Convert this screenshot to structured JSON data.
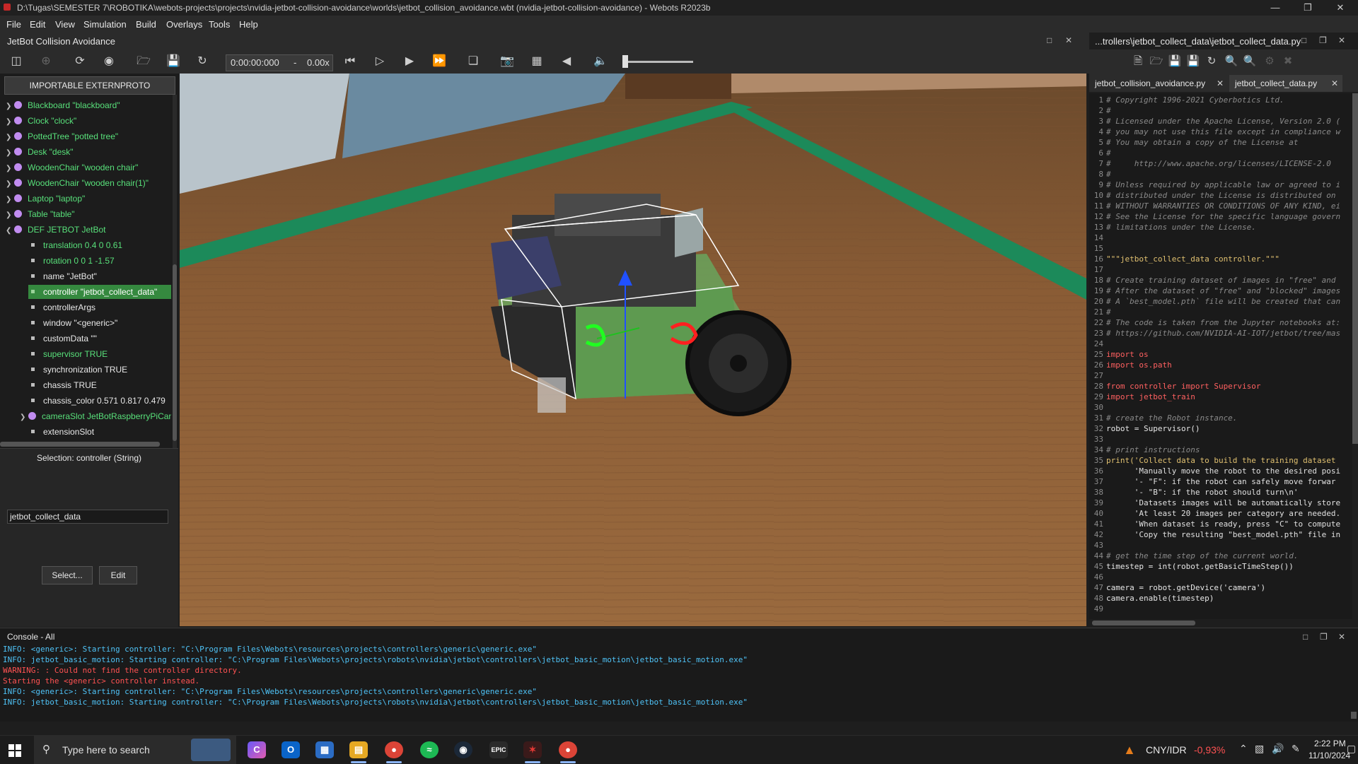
{
  "window": {
    "title": "D:\\Tugas\\SEMESTER 7\\ROBOTIKA\\webots-projects\\projects\\nvidia-jetbot-collision-avoidance\\worlds\\jetbot_collision_avoidance.wbt (nvidia-jetbot-collision-avoidance) - Webots R2023b"
  },
  "menu": [
    "File",
    "Edit",
    "View",
    "Simulation",
    "Build",
    "Overlays",
    "Tools",
    "Help"
  ],
  "world_title": "JetBot Collision Avoidance",
  "toolbar": {
    "time": "0:00:00:000",
    "separator": "-",
    "speed": "0.00x"
  },
  "scene_tree": {
    "proto_button": "IMPORTABLE EXTERNPROTO",
    "nodes": [
      "Blackboard \"blackboard\"",
      "Clock \"clock\"",
      "PottedTree \"potted tree\"",
      "Desk \"desk\"",
      "WoodenChair \"wooden chair\"",
      "WoodenChair \"wooden chair(1)\"",
      "Laptop \"laptop\"",
      "Table \"table\"",
      "DEF JETBOT JetBot"
    ],
    "fields": [
      "translation 0.4 0 0.61",
      "rotation 0 0 1 -1.57",
      "name \"JetBot\"",
      "controller \"jetbot_collect_data\"",
      "controllerArgs",
      "window \"<generic>\"",
      "customData \"\"",
      "supervisor TRUE",
      "synchronization TRUE",
      "chassis TRUE",
      "chassis_color 0.571 0.817 0.479",
      "cameraSlot JetBotRaspberryPiCamera",
      "extensionSlot"
    ]
  },
  "selection": {
    "label": "Selection: controller (String)",
    "value": "jetbot_collect_data",
    "select_button": "Select...",
    "edit_button": "Edit"
  },
  "editor": {
    "title": "...trollers\\jetbot_collect_data\\jetbot_collect_data.py",
    "tabs": [
      "jetbot_collision_avoidance.py",
      "jetbot_collect_data.py"
    ],
    "code_lines": [
      "# Copyright 1996-2021 Cyberbotics Ltd.",
      "#",
      "# Licensed under the Apache License, Version 2.0 (",
      "# you may not use this file except in compliance w",
      "# You may obtain a copy of the License at",
      "#",
      "#     http://www.apache.org/licenses/LICENSE-2.0",
      "#",
      "# Unless required by applicable law or agreed to i",
      "# distributed under the License is distributed on",
      "# WITHOUT WARRANTIES OR CONDITIONS OF ANY KIND, ei",
      "# See the License for the specific language govern",
      "# limitations under the License.",
      "",
      "",
      "\"\"\"jetbot_collect_data controller.\"\"\"",
      "",
      "# Create training dataset of images in \"free\" and",
      "# After the dataset of \"free\" and \"blocked\" images",
      "# A `best_model.pth` file will be created that can",
      "#",
      "# The code is taken from the Jupyter notebooks at:",
      "# https://github.com/NVIDIA-AI-IOT/jetbot/tree/mas",
      "",
      "import os",
      "import os.path",
      "",
      "from controller import Supervisor",
      "import jetbot_train",
      "",
      "# create the Robot instance.",
      "robot = Supervisor()",
      "",
      "# print instructions",
      "print('Collect data to build the training dataset",
      "      'Manually move the robot to the desired posi",
      "      '- \"F\": if the robot can safely move forwar",
      "      '- \"B\": if the robot should turn\\n'",
      "      'Datasets images will be automatically store",
      "      'At least 20 images per category are needed.",
      "      'When dataset is ready, press \"C\" to compute",
      "      'Copy the resulting \"best_model.pth\" file in",
      "",
      "# get the time step of the current world.",
      "timestep = int(robot.getBasicTimeStep())",
      "",
      "camera = robot.getDevice('camera')",
      "camera.enable(timestep)",
      ""
    ]
  },
  "console": {
    "title": "Console - All",
    "lines": [
      {
        "text": "INFO: <generic>: Starting controller: \"C:\\Program Files\\Webots\\resources\\projects\\controllers\\generic\\generic.exe\"",
        "color": "#4fc3f7"
      },
      {
        "text": "INFO: jetbot_basic_motion: Starting controller: \"C:\\Program Files\\Webots\\projects\\robots\\nvidia\\jetbot\\controllers\\jetbot_basic_motion\\jetbot_basic_motion.exe\"",
        "color": "#4fc3f7"
      },
      {
        "text": "WARNING: : Could not find the controller directory.",
        "color": "#ff5252"
      },
      {
        "text": "Starting the <generic> controller instead.",
        "color": "#ff5252"
      },
      {
        "text": "INFO: <generic>: Starting controller: \"C:\\Program Files\\Webots\\resources\\projects\\controllers\\generic\\generic.exe\"",
        "color": "#4fc3f7"
      },
      {
        "text": "INFO: jetbot_basic_motion: Starting controller: \"C:\\Program Files\\Webots\\projects\\robots\\nvidia\\jetbot\\controllers\\jetbot_basic_motion\\jetbot_basic_motion.exe\"",
        "color": "#4fc3f7"
      }
    ]
  },
  "taskbar": {
    "search_placeholder": "Type here to search",
    "ticker_name": "CNY/IDR",
    "ticker_change": "-0,93%",
    "time": "2:22 PM",
    "date": "11/10/2024"
  },
  "colors": {
    "accent_green": "#35893f",
    "tree_green": "#58e07a",
    "console_info": "#4fc3f7",
    "console_warn": "#ff5252",
    "ticker_red": "#ff5252"
  }
}
